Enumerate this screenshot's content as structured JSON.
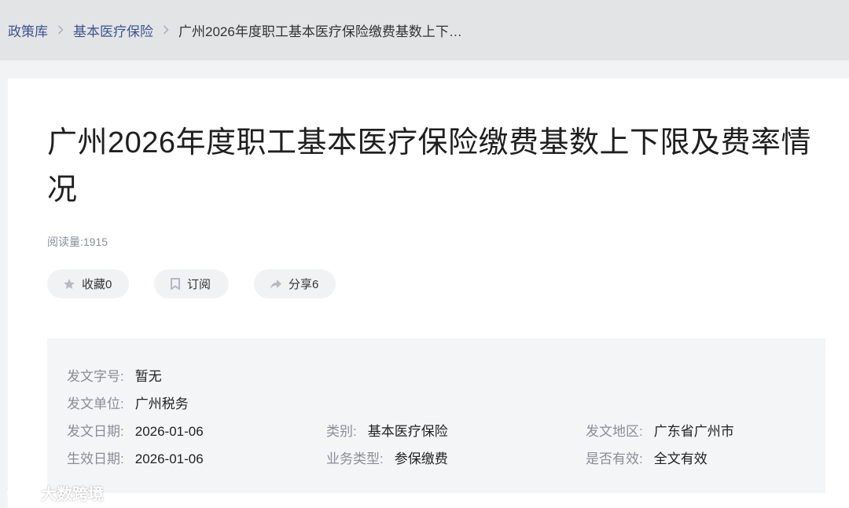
{
  "breadcrumb": {
    "items": [
      "政策库",
      "基本医疗保险"
    ],
    "current": "广州2026年度职工基本医疗保险缴费基数上下…"
  },
  "article": {
    "title": "广州2026年度职工基本医疗保险缴费基数上下限及费率情况",
    "reads": "阅读量:1915"
  },
  "actions": {
    "favorite": "收藏0",
    "subscribe": "订阅",
    "share": "分享6"
  },
  "meta": {
    "doc_number": {
      "label": "发文字号:",
      "value": "暂无"
    },
    "issuer": {
      "label": "发文单位:",
      "value": "广州税务"
    },
    "issue_date": {
      "label": "发文日期:",
      "value": "2026-01-06"
    },
    "category": {
      "label": "类别:",
      "value": "基本医疗保险"
    },
    "region": {
      "label": "发文地区:",
      "value": "广东省广州市"
    },
    "effective_date": {
      "label": "生效日期:",
      "value": "2026-01-06"
    },
    "business_type": {
      "label": "业务类型:",
      "value": "参保缴费"
    },
    "validity": {
      "label": "是否有效:",
      "value": "全文有效"
    }
  },
  "watermark": "大数跨境",
  "colors": {
    "link": "#3c5590",
    "label": "#8a8d93",
    "pill_bg": "#f1f2f4",
    "meta_bg": "#f4f5f7"
  }
}
